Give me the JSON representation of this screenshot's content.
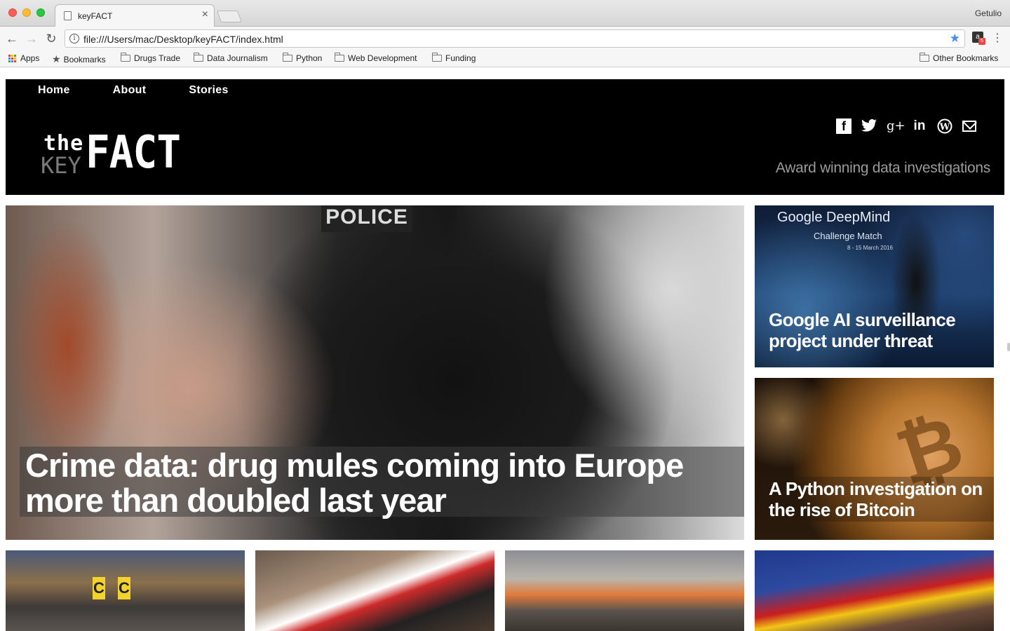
{
  "browser": {
    "tab_title": "keyFACT",
    "tab_close": "×",
    "profile_name": "Getulio",
    "url": "file:///Users/mac/Desktop/keyFACT/index.html",
    "nav": {
      "back": "←",
      "forward": "→",
      "reload": "↻"
    },
    "star_glyph": "★",
    "menu_glyph": "⋮",
    "extension_badge": "5",
    "bookmarks": [
      {
        "label": "Apps",
        "icon": "apps-grid-icon"
      },
      {
        "label": "Bookmarks",
        "icon": "star-icon"
      },
      {
        "label": "Drugs Trade",
        "icon": "folder-icon"
      },
      {
        "label": "Data Journalism",
        "icon": "folder-icon"
      },
      {
        "label": "Python",
        "icon": "folder-icon"
      },
      {
        "label": "Web Development",
        "icon": "folder-icon"
      },
      {
        "label": "Funding",
        "icon": "folder-icon"
      }
    ],
    "other_bookmarks": "Other Bookmarks"
  },
  "site": {
    "nav": [
      "Home",
      "About",
      "Stories"
    ],
    "logo": {
      "the": "the",
      "key": "KEY",
      "fact": "FACT"
    },
    "social": [
      "f",
      "🐦",
      "g+",
      "in",
      "W",
      ""
    ],
    "social_icons": [
      "facebook-icon",
      "twitter-icon",
      "google-plus-icon",
      "linkedin-icon",
      "wordpress-icon",
      "email-icon"
    ],
    "tagline": "Award winning data investigations",
    "colors": {
      "header_bg": "#000000",
      "tagline": "#9a9a9a",
      "logo_key": "#7a7a7a"
    }
  },
  "stories": {
    "hero": {
      "title": "Crime data: drug mules coming into Europe more than doubled last year",
      "image_text": "POLICE"
    },
    "side1": {
      "title": "Google AI surveillance project under threat",
      "image_heading": "Google DeepMind",
      "image_sub": "Challenge Match",
      "image_date": "8 - 15 March 2016"
    },
    "side2": {
      "title": "A Python investigation on the rise of Bitcoin",
      "image_symbol": "₿"
    },
    "bottom": [
      {
        "image_text": [
          "C",
          "C"
        ]
      },
      {
        "image_text": []
      },
      {
        "image_text": []
      },
      {
        "image_text": []
      }
    ]
  }
}
